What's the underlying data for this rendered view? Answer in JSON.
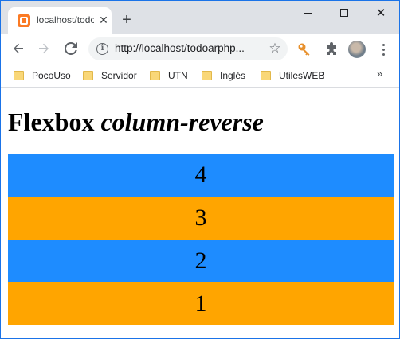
{
  "browser": {
    "tab": {
      "title": "localhost/todo",
      "close": "✕"
    },
    "new_tab": "+",
    "window_controls": {
      "minimize": "",
      "maximize": "",
      "close": "✕"
    },
    "url": "http://localhost/todoarphp...",
    "bookmarks": [
      "PocoUso",
      "Servidor",
      "UTN",
      "Inglés",
      "UtilesWEB"
    ],
    "bookmarks_more": "»",
    "icons": {
      "back": "arrow-left-icon",
      "forward": "arrow-right-icon",
      "reload": "reload-icon",
      "info": "info-icon",
      "star": "star-icon",
      "key": "key-icon",
      "extensions": "puzzle-icon",
      "menu": "kebab-menu-icon"
    },
    "colors": {
      "accent": "#1a73e8",
      "key": "#e8912d"
    }
  },
  "page": {
    "heading": {
      "prefix": "Flexbox ",
      "emphasis": "column-reverse"
    },
    "items": [
      {
        "label": "4",
        "color": "#1e8cff"
      },
      {
        "label": "3",
        "color": "#ffa500"
      },
      {
        "label": "2",
        "color": "#1e8cff"
      },
      {
        "label": "1",
        "color": "#ffa500"
      }
    ]
  }
}
